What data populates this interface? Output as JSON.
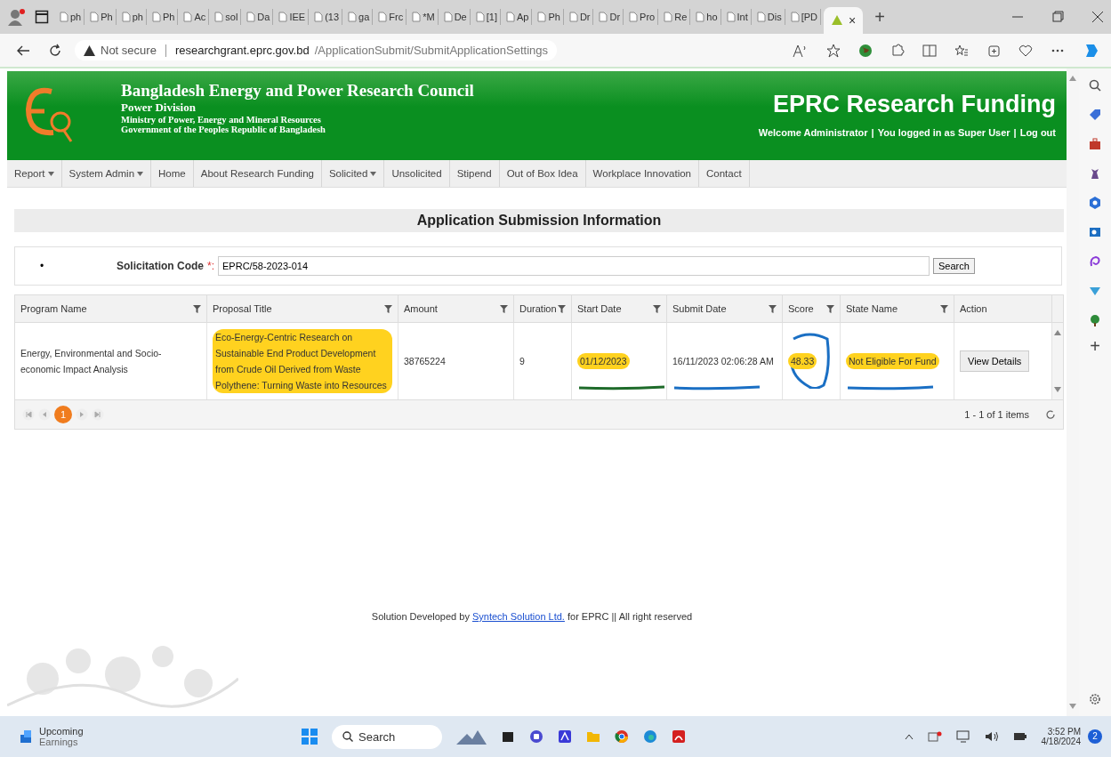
{
  "browser": {
    "tabs": [
      {
        "label": "ph",
        "selected": false
      },
      {
        "label": "Ph",
        "selected": false
      },
      {
        "label": "ph",
        "selected": false
      },
      {
        "label": "Ph",
        "selected": false
      },
      {
        "label": "Ac",
        "selected": false
      },
      {
        "label": "sol",
        "selected": false
      },
      {
        "label": "Da",
        "selected": false
      },
      {
        "label": "IEE",
        "selected": false
      },
      {
        "label": "(13",
        "selected": false
      },
      {
        "label": "ga",
        "selected": false
      },
      {
        "label": "Frc",
        "selected": false
      },
      {
        "label": "*M",
        "selected": false
      },
      {
        "label": "De",
        "selected": false
      },
      {
        "label": "[1]",
        "selected": false
      },
      {
        "label": "Ap",
        "selected": false
      },
      {
        "label": "Ph",
        "selected": false
      },
      {
        "label": "Dr",
        "selected": false
      },
      {
        "label": "Dr",
        "selected": false
      },
      {
        "label": "Pro",
        "selected": false
      },
      {
        "label": "Re",
        "selected": false
      },
      {
        "label": "ho",
        "selected": false
      },
      {
        "label": "Int",
        "selected": false
      },
      {
        "label": "Dis",
        "selected": false
      },
      {
        "label": "[PD",
        "selected": false
      },
      {
        "close": "×",
        "selected": true
      }
    ],
    "new_tab": "+",
    "address": {
      "warning": "Not secure",
      "host": "researchgrant.eprc.gov.bd",
      "path": "/ApplicationSubmit/SubmitApplicationSettings"
    },
    "sidebar_add": "+"
  },
  "header": {
    "org": "Bangladesh Energy and Power Research Council",
    "division": "Power Division",
    "ministry": "Ministry of Power, Energy and Mineral Resources",
    "government": "Government of the Peoples Republic of Bangladesh",
    "site_title": "EPRC Research Funding",
    "user_links": [
      "Welcome Administrator",
      "You logged in as Super User",
      "Log out"
    ],
    "separator": "|"
  },
  "nav": [
    {
      "label": "Report",
      "dropdown": true
    },
    {
      "label": "System Admin",
      "dropdown": true
    },
    {
      "label": "Home",
      "dropdown": false
    },
    {
      "label": "About Research Funding",
      "dropdown": false
    },
    {
      "label": "Solicited",
      "dropdown": true
    },
    {
      "label": "Unsolicited",
      "dropdown": false
    },
    {
      "label": "Stipend",
      "dropdown": false
    },
    {
      "label": "Out of Box Idea",
      "dropdown": false
    },
    {
      "label": "Workplace Innovation",
      "dropdown": false
    },
    {
      "label": "Contact",
      "dropdown": false
    }
  ],
  "page_title": "Application Submission Information",
  "search": {
    "bullet": "•",
    "label": "Solicitation Code",
    "required": "*:",
    "value": "EPRC/58-2023-014",
    "button": "Search"
  },
  "table": {
    "columns": [
      "Program Name",
      "Proposal Title",
      "Amount",
      "Duration",
      "Start Date",
      "Submit Date",
      "Score",
      "State Name",
      "Action"
    ],
    "rows": [
      {
        "cells": [
          {
            "text": "Energy, Environmental and Socio-economic Impact Analysis",
            "highlighted": false
          },
          {
            "text": "Eco-Energy-Centric Research on Sustainable End Product Development from Crude Oil Derived from Waste Polythene: Turning Waste into Resources",
            "highlighted": true
          },
          {
            "text": "38765224",
            "highlighted": false
          },
          {
            "text": "9",
            "highlighted": false
          },
          {
            "text": "01/12/2023",
            "highlighted": true,
            "pen": {
              "kind": "underline",
              "color": "#1e6b2a"
            }
          },
          {
            "text": "16/11/2023 02:06:28 AM",
            "highlighted": false,
            "pen": {
              "kind": "underline",
              "color": "#1a6fc4"
            }
          },
          {
            "text": "48.33",
            "highlighted": true,
            "pen": {
              "kind": "circle",
              "color": "#1a6fc4"
            }
          },
          {
            "text": "Not Eligible For Fund",
            "highlighted": true,
            "pen": {
              "kind": "underline",
              "color": "#1a6fc4"
            }
          }
        ],
        "action": "View Details"
      }
    ]
  },
  "pager": {
    "pages": [
      {
        "label": "1",
        "selected": true
      }
    ],
    "summary": "1 - 1 of 1 items"
  },
  "footer": {
    "before": "Solution Developed by ",
    "link": "Syntech Solution Ltd.",
    "after": " for EPRC || All right reserved"
  },
  "taskbar": {
    "weather": [
      "Upcoming",
      "Earnings"
    ],
    "search": "Search",
    "time": "3:52 PM",
    "date": "4/18/2024",
    "badge": "2"
  }
}
